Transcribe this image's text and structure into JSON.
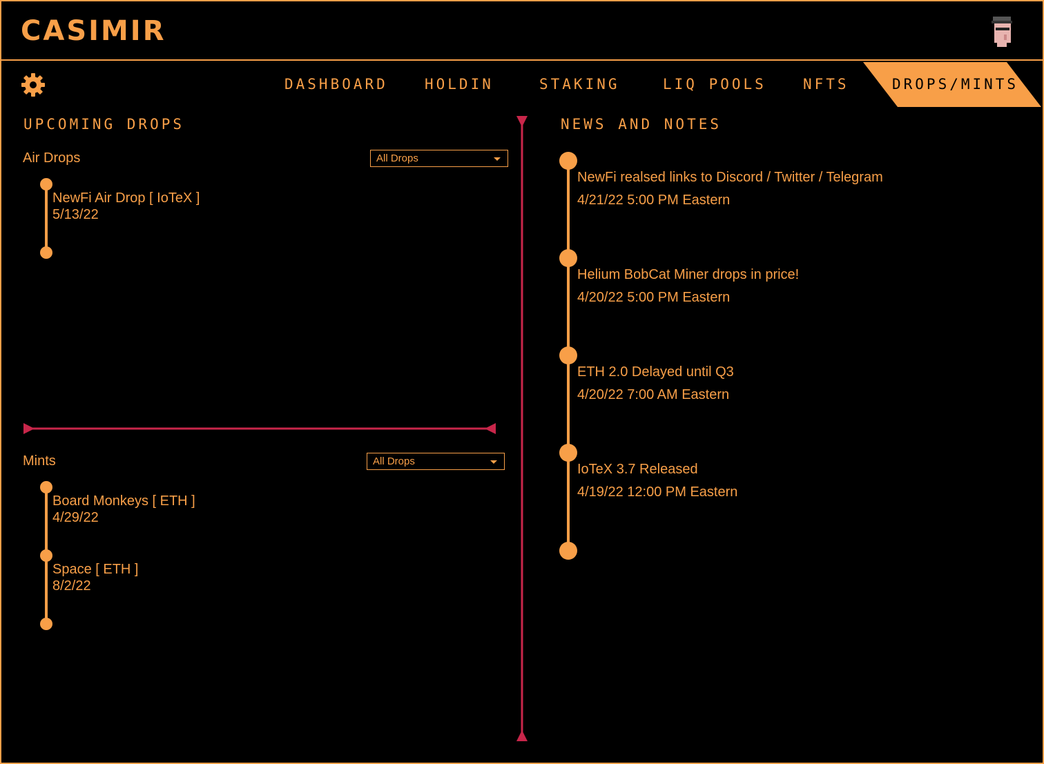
{
  "app": {
    "logo": "CASIMIR"
  },
  "colors": {
    "accent": "#f89f48",
    "divider": "#c8264a",
    "background": "#000000"
  },
  "nav": {
    "items": [
      {
        "label": "DASHBOARD"
      },
      {
        "label": "HOLDIN"
      },
      {
        "label": "STAKING"
      },
      {
        "label": "LIQ POOLS"
      },
      {
        "label": "NFTS"
      },
      {
        "label": "DROPS/MINTS",
        "active": true
      }
    ]
  },
  "upcoming": {
    "title": "UPCOMING DROPS",
    "airdrops": {
      "label": "Air Drops",
      "filter": "All Drops",
      "items": [
        {
          "name": "NewFi Air Drop [ IoTeX ]",
          "date": "5/13/22"
        }
      ]
    },
    "mints": {
      "label": "Mints",
      "filter": "All Drops",
      "items": [
        {
          "name": "Board Monkeys [ ETH ]",
          "date": "4/29/22"
        },
        {
          "name": "Space  [ ETH ]",
          "date": "8/2/22"
        }
      ]
    }
  },
  "news": {
    "title": "NEWS AND NOTES",
    "items": [
      {
        "headline": "NewFi realsed links to Discord / Twitter / Telegram",
        "time": "4/21/22 5:00 PM Eastern"
      },
      {
        "headline": "Helium BobCat Miner drops in price!",
        "time": "4/20/22 5:00 PM Eastern"
      },
      {
        "headline": "ETH 2.0 Delayed until Q3",
        "time": "4/20/22 7:00 AM Eastern"
      },
      {
        "headline": "IoTeX 3.7 Released",
        "time": "4/19/22 12:00 PM Eastern"
      }
    ]
  }
}
